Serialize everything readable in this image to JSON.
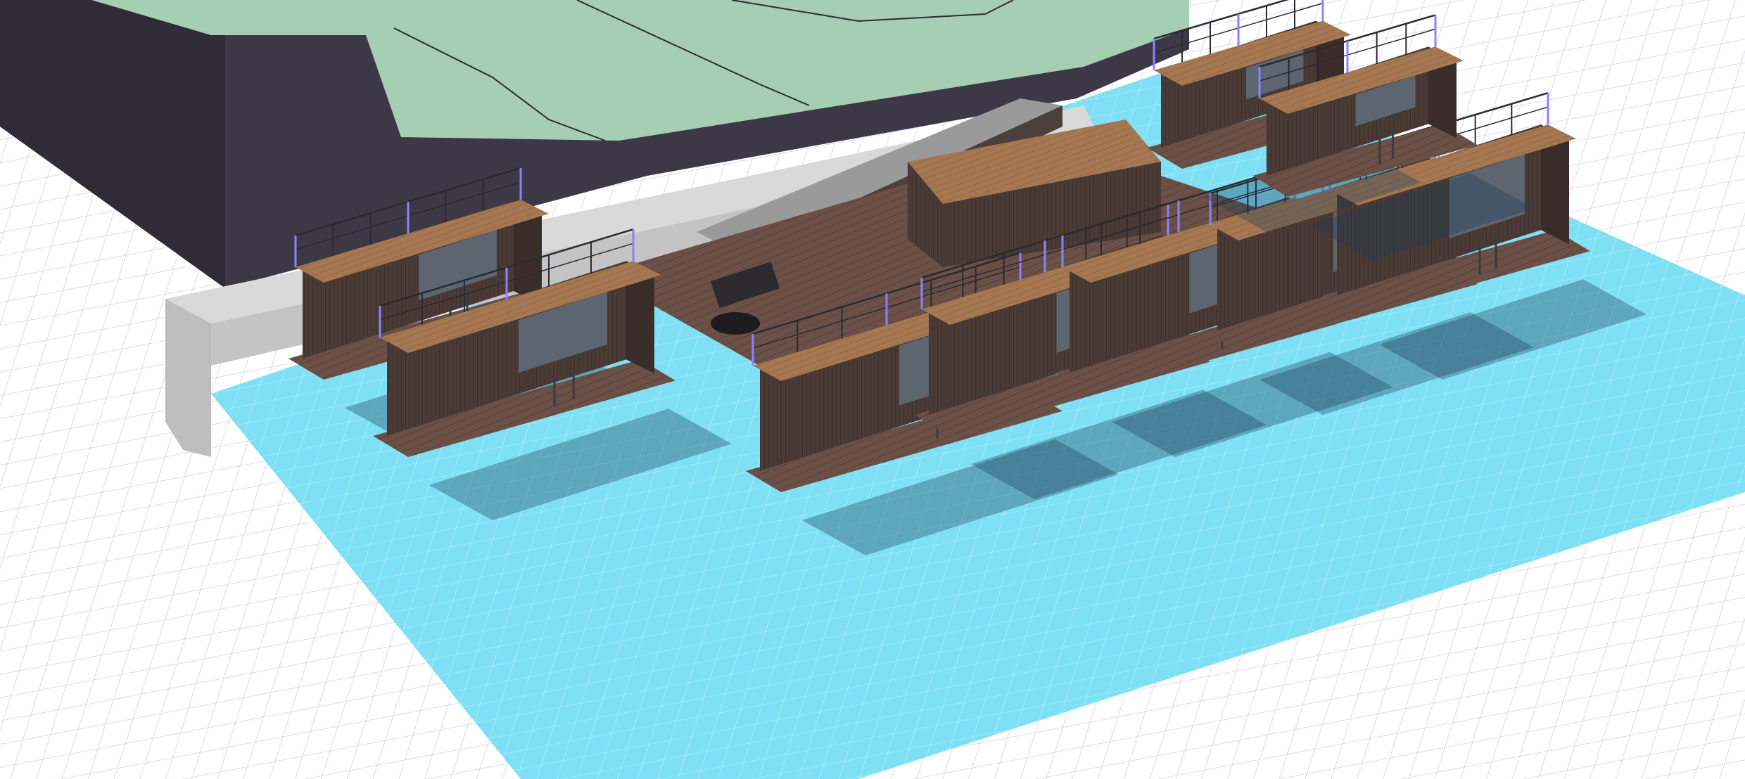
{
  "viewport": {
    "view_type": "3d-perspective",
    "background_color": "#ffffff",
    "grid_color": "#c9cde6"
  },
  "model": {
    "subject": "floating-houseboat-marina",
    "water_color": "#7fe0f5",
    "terrain_top_color": "#a6ceb2",
    "terrain_side_color": "#3d3845",
    "quay_color": "#d9d9d9",
    "deck_wood_color": "#6b5048",
    "roof_wood_color": "#a57852",
    "wall_wood_color": "#4a3a35",
    "railing_color": "#2a2a30",
    "post_highlight_color": "#8b82ff",
    "window_color": "#5c6570",
    "houseboat_count": 9
  }
}
